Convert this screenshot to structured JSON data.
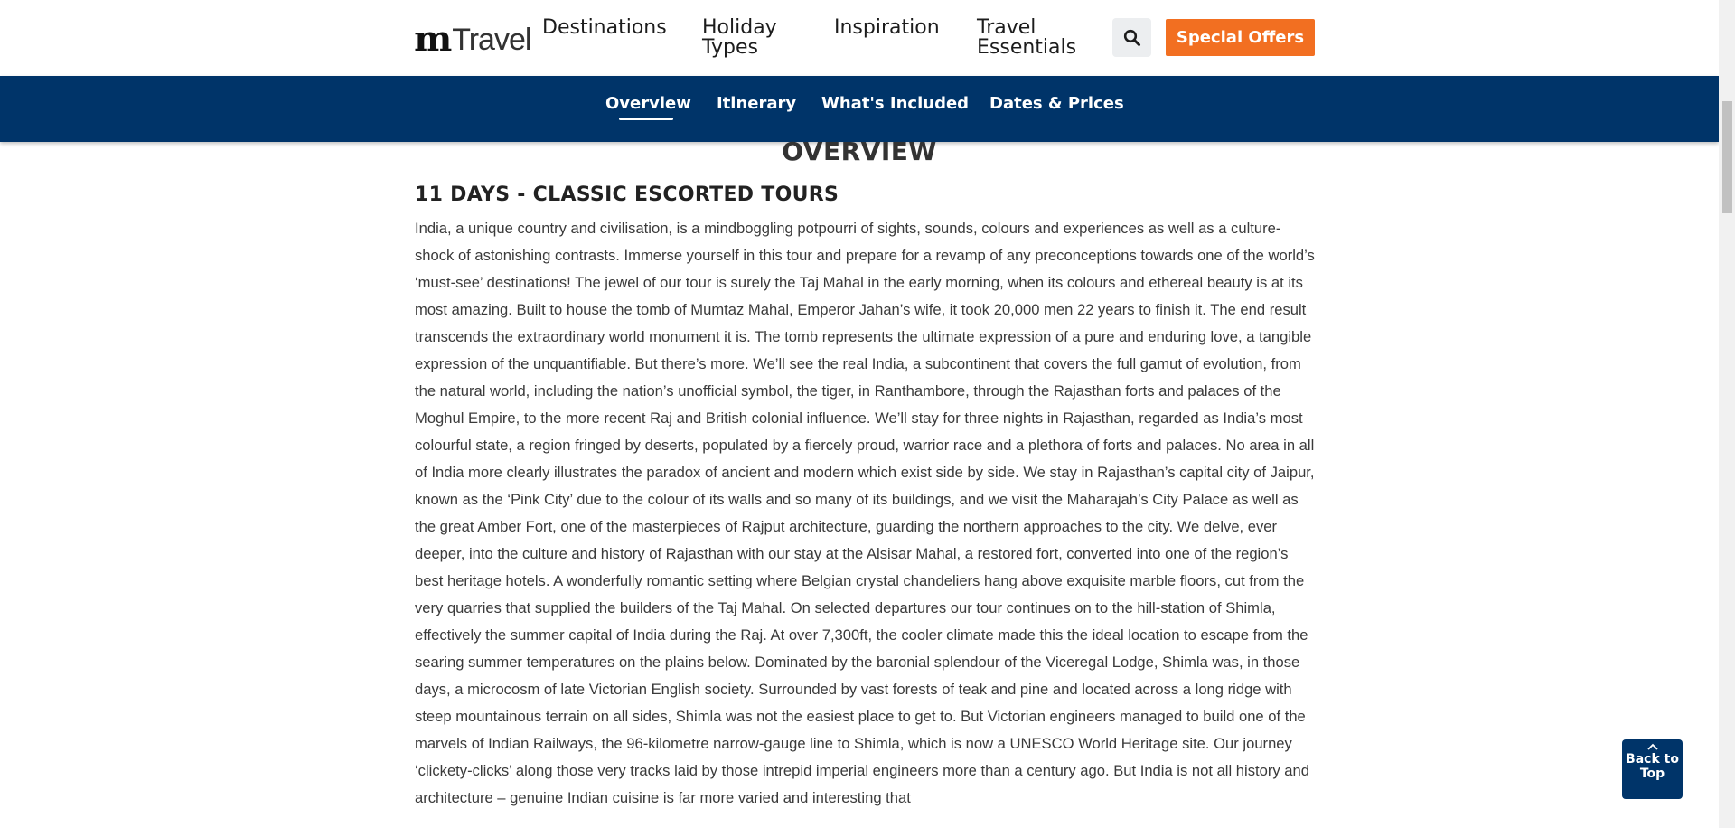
{
  "header": {
    "logo": {
      "mark": "m",
      "text": "Travel"
    },
    "nav": [
      {
        "lines": [
          "Destinations"
        ]
      },
      {
        "lines": [
          "Holiday",
          "Types"
        ]
      },
      {
        "lines": [
          "Inspiration"
        ]
      },
      {
        "lines": [
          "Travel",
          "Essentials"
        ]
      }
    ],
    "search_icon": "search-icon",
    "special_offers_label": "Special Offers",
    "colors": {
      "offers": "#f26f21",
      "search_bg": "#eceef0"
    }
  },
  "sub_nav": {
    "items": [
      {
        "label": "Overview",
        "active": true
      },
      {
        "label": "Itinerary",
        "active": false
      },
      {
        "label": "What's Included",
        "active": false
      },
      {
        "label": "Dates & Prices",
        "active": false
      }
    ],
    "background": "#003469"
  },
  "content": {
    "section_title": "OVERVIEW",
    "tour_title": "11 DAYS - CLASSIC ESCORTED TOURS",
    "description": "India, a unique country and civilisation, is a mindboggling potpourri of sights, sounds, colours and experiences as well as a culture-shock of astonishing contrasts. Immerse yourself in this tour and prepare for a revamp of any preconceptions towards one of the world’s ‘must-see’ destinations! The jewel of our tour is surely the Taj Mahal in the early morning, when its colours and ethereal beauty is at its most amazing. Built to house the tomb of Mumtaz Mahal, Emperor Jahan’s wife, it took 20,000 men 22 years to finish it. The end result transcends the extraordinary world monument it is. The tomb represents the ultimate expression of a pure and enduring love, a tangible expression of the unquantifiable. But there’s more. We’ll see the real India, a subcontinent that covers the full gamut of evolution, from the natural world, including the nation’s unofficial symbol, the tiger, in Ranthambore, through the Rajasthan forts and palaces of the Moghul Empire, to the more recent Raj and British colonial influence. We’ll stay for three nights in Rajasthan, regarded as India’s most colourful state, a region fringed by deserts, populated by a fiercely proud, warrior race and a plethora of forts and palaces. No area in all of India more clearly illustrates the paradox of ancient and modern which exist side by side. We stay in Rajasthan’s capital city of Jaipur, known as the ‘Pink City’ due to the colour of its walls and so many of its buildings, and we visit the Maharajah’s City Palace as well as the great Amber Fort, one of the masterpieces of Rajput architecture, guarding the northern approaches to the city. We delve, ever deeper, into the culture and history of Rajasthan with our stay at the Alsisar Mahal, a restored fort, converted into one of the region’s best heritage hotels. A wonderfully romantic setting where Belgian crystal chandeliers hang above exquisite marble floors, cut from the very quarries that supplied the builders of the Taj Mahal. On selected departures our tour continues on to the hill-station of Shimla, effectively the summer capital of India during the Raj. At over 7,300ft, the cooler climate made this the ideal location to escape from the searing summer temperatures on the plains below. Dominated by the baronial splendour of the Viceregal Lodge, Shimla was, in those days, a microcosm of late Victorian English society. Surrounded by vast forests of teak and pine and located across a long ridge with steep mountainous terrain on all sides, Shimla was not the easiest place to get to. But Victorian engineers managed to build one of the marvels of Indian Railways, the 96-kilometre narrow-gauge line to Shimla, which is now a UNESCO World Heritage site. Our journey ‘clickety-clicks’ along those very tracks laid by those intrepid imperial engineers more than a century ago. But India is not all history and architecture – genuine Indian cuisine is far more varied and interesting that"
  },
  "back_to_top": {
    "lines": [
      "Back to",
      "Top"
    ],
    "icon": "chevron-up-icon"
  }
}
